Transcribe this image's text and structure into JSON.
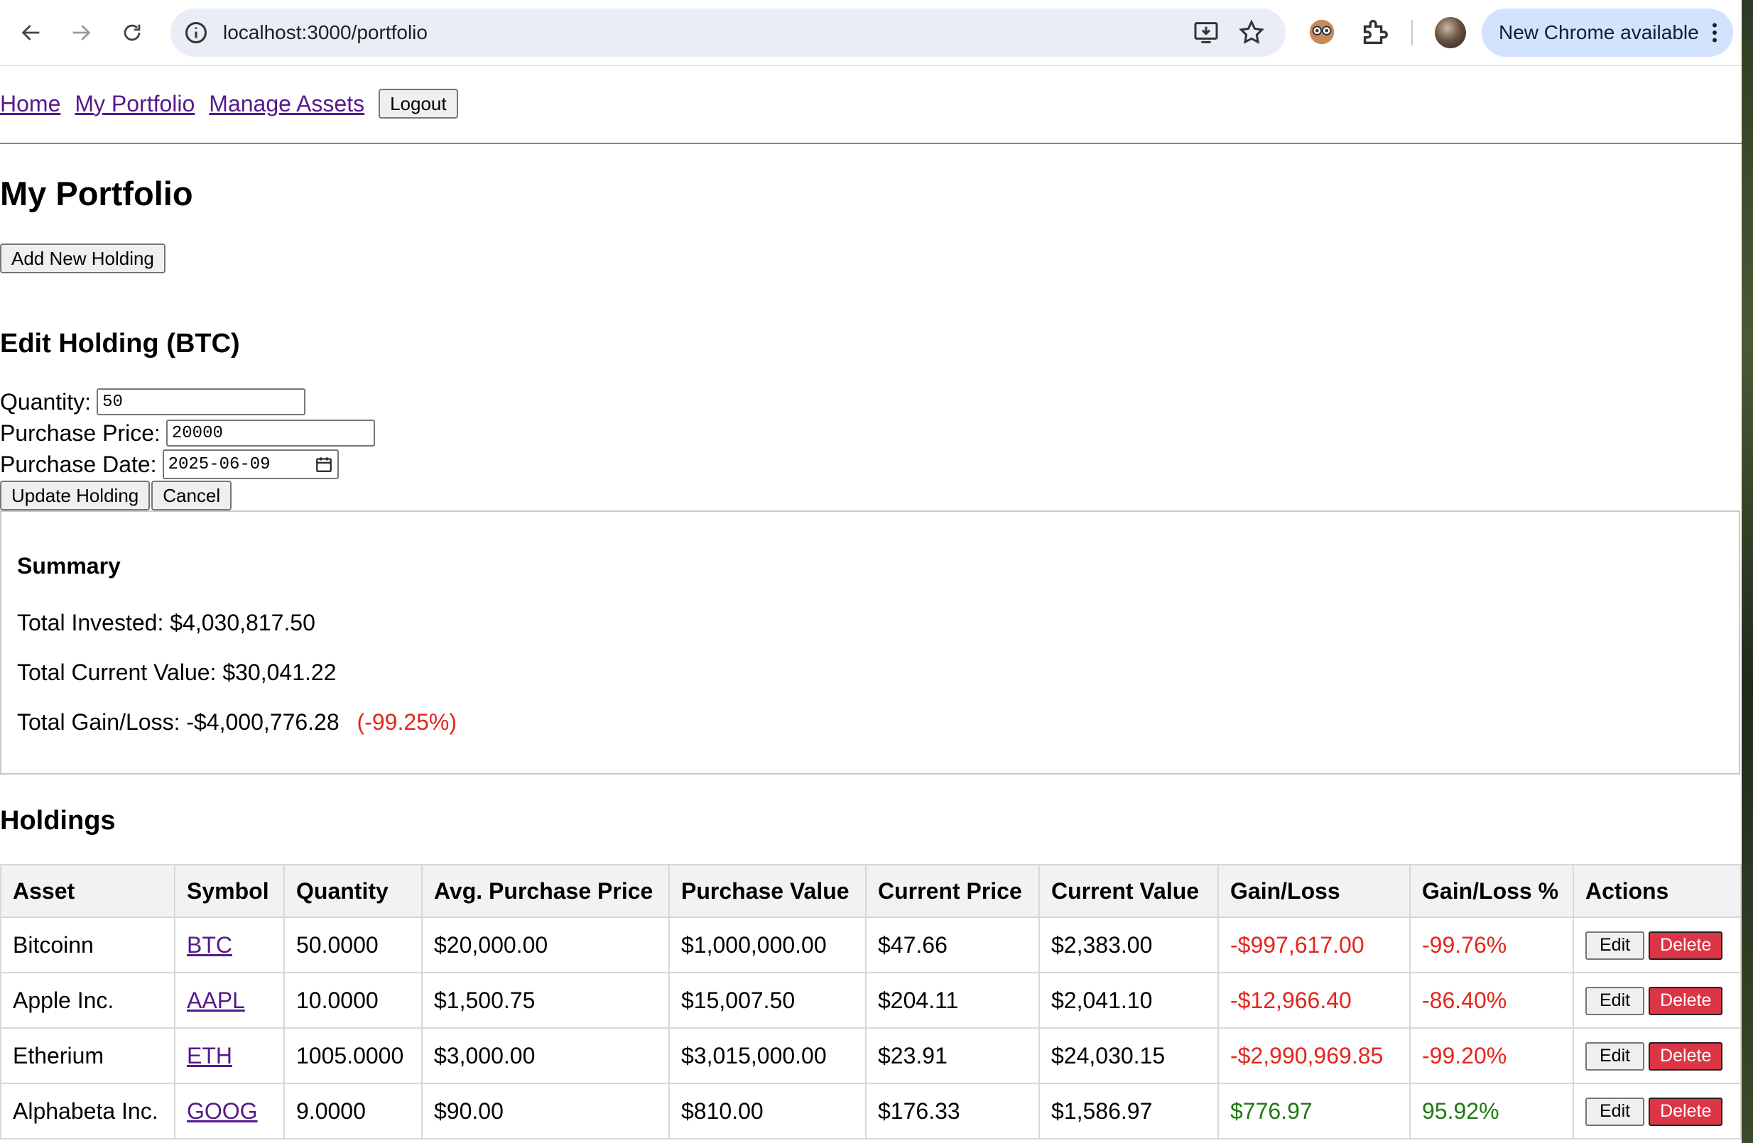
{
  "browser": {
    "url": "localhost:3000/portfolio",
    "update_label": "New Chrome available"
  },
  "nav": {
    "home": "Home",
    "portfolio": "My Portfolio",
    "manage": "Manage Assets",
    "logout": "Logout"
  },
  "page": {
    "title": "My Portfolio",
    "add_button": "Add New Holding"
  },
  "edit_form": {
    "title": "Edit Holding (BTC)",
    "quantity_label": "Quantity:",
    "quantity_value": "50",
    "price_label": "Purchase Price:",
    "price_value": "20000",
    "date_label": "Purchase Date:",
    "date_value": "2025-06-09",
    "update_button": "Update Holding",
    "cancel_button": "Cancel"
  },
  "summary": {
    "title": "Summary",
    "total_invested": "Total Invested: $4,030,817.50",
    "total_current": "Total Current Value: $30,041.22",
    "total_gain_label": "Total Gain/Loss: -$4,000,776.28",
    "total_gain_pct": "(-99.25%)"
  },
  "holdings": {
    "title": "Holdings",
    "columns": [
      "Asset",
      "Symbol",
      "Quantity",
      "Avg. Purchase Price",
      "Purchase Value",
      "Current Price",
      "Current Value",
      "Gain/Loss",
      "Gain/Loss %",
      "Actions"
    ],
    "edit_label": "Edit",
    "delete_label": "Delete",
    "rows": [
      {
        "asset": "Bitcoinn",
        "symbol": "BTC",
        "quantity": "50.0000",
        "avg_price": "$20,000.00",
        "purchase_value": "$1,000,000.00",
        "current_price": "$47.66",
        "current_value": "$2,383.00",
        "gain": "-$997,617.00",
        "gain_pct": "-99.76%",
        "trend": "neg"
      },
      {
        "asset": "Apple Inc.",
        "symbol": "AAPL",
        "quantity": "10.0000",
        "avg_price": "$1,500.75",
        "purchase_value": "$15,007.50",
        "current_price": "$204.11",
        "current_value": "$2,041.10",
        "gain": "-$12,966.40",
        "gain_pct": "-86.40%",
        "trend": "neg"
      },
      {
        "asset": "Etherium",
        "symbol": "ETH",
        "quantity": "1005.0000",
        "avg_price": "$3,000.00",
        "purchase_value": "$3,015,000.00",
        "current_price": "$23.91",
        "current_value": "$24,030.15",
        "gain": "-$2,990,969.85",
        "gain_pct": "-99.20%",
        "trend": "neg"
      },
      {
        "asset": "Alphabeta Inc.",
        "symbol": "GOOG",
        "quantity": "9.0000",
        "avg_price": "$90.00",
        "purchase_value": "$810.00",
        "current_price": "$176.33",
        "current_value": "$1,586.97",
        "gain": "$776.97",
        "gain_pct": "95.92%",
        "trend": "pos"
      }
    ]
  },
  "colors": {
    "negative": "#e3261c",
    "positive": "#1f7a12",
    "delete_button": "#dc3545",
    "link": "#551a8b"
  }
}
